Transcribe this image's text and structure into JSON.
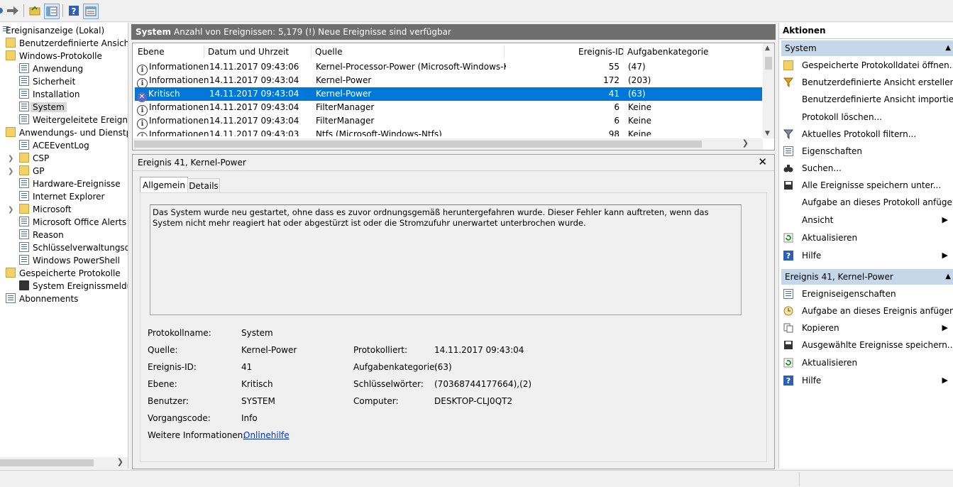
{
  "toolbar": {
    "icons": [
      "back-arrow-icon",
      "forward-arrow-icon",
      "open-folder-icon",
      "console-tree-icon",
      "help-icon",
      "action-pane-icon"
    ]
  },
  "tree": {
    "items": [
      {
        "label": "Ereignisanzeige (Lokal)"
      },
      {
        "label": "Benutzerdefinierte Ansichten"
      },
      {
        "label": "Windows-Protokolle"
      },
      {
        "label": "Anwendung"
      },
      {
        "label": "Sicherheit"
      },
      {
        "label": "Installation"
      },
      {
        "label": "System"
      },
      {
        "label": "Weitergeleitete Ereignisse"
      },
      {
        "label": "Anwendungs- und Dienstprotokolle"
      },
      {
        "label": "ACEEventLog"
      },
      {
        "label": "CSP"
      },
      {
        "label": "GP"
      },
      {
        "label": "Hardware-Ereignisse"
      },
      {
        "label": "Internet Explorer"
      },
      {
        "label": "Microsoft"
      },
      {
        "label": "Microsoft Office Alerts"
      },
      {
        "label": "Reason"
      },
      {
        "label": "Schlüsselverwaltungsdienst"
      },
      {
        "label": "Windows PowerShell"
      },
      {
        "label": "Gespeicherte Protokolle"
      },
      {
        "label": "System Ereignissmeldung"
      },
      {
        "label": "Abonnements"
      }
    ]
  },
  "center": {
    "title": "System",
    "subtitle": "Anzahl von Ereignissen: 5,179 (!) Neue Ereignisse sind verfügbar",
    "columns": [
      "Ebene",
      "Datum und Uhrzeit",
      "Quelle",
      "Ereignis-ID",
      "Aufgabenkategorie"
    ],
    "rows": [
      {
        "level": "Informationen",
        "date": "14.11.2017 09:43:06",
        "source": "Kernel-Processor-Power (Microsoft-Windows-K...",
        "id": "55",
        "category": "(47)"
      },
      {
        "level": "Informationen",
        "date": "14.11.2017 09:43:04",
        "source": "Kernel-Power",
        "id": "172",
        "category": "(203)"
      },
      {
        "level": "Kritisch",
        "date": "14.11.2017 09:43:04",
        "source": "Kernel-Power",
        "id": "41",
        "category": "(63)"
      },
      {
        "level": "Informationen",
        "date": "14.11.2017 09:43:04",
        "source": "FilterManager",
        "id": "6",
        "category": "Keine"
      },
      {
        "level": "Informationen",
        "date": "14.11.2017 09:43:04",
        "source": "FilterManager",
        "id": "6",
        "category": "Keine"
      },
      {
        "level": "Informationen",
        "date": "14.11.2017 09:43:03",
        "source": "Ntfs (Microsoft-Windows-Ntfs)",
        "id": "98",
        "category": "Keine"
      }
    ]
  },
  "detail": {
    "title": "Ereignis 41, Kernel-Power",
    "tabs": [
      "Allgemein",
      "Details"
    ],
    "message": "Das System wurde neu gestartet, ohne dass es zuvor ordnungsgemäß heruntergefahren wurde. Dieser Fehler kann auftreten, wenn das System nicht mehr reagiert hat oder abgestürzt ist oder die Stromzufuhr unerwartet unterbrochen wurde.",
    "fields": {
      "logname_label": "Protokollname:",
      "logname": "System",
      "source_label": "Quelle:",
      "source": "Kernel-Power",
      "logged_label": "Protokolliert:",
      "logged": "14.11.2017 09:43:04",
      "eventid_label": "Ereignis-ID:",
      "eventid": "41",
      "taskcat_label": "Aufgabenkategorie:",
      "taskcat": "(63)",
      "level_label": "Ebene:",
      "level": "Kritisch",
      "keywords_label": "Schlüsselwörter:",
      "keywords": "(70368744177664),(2)",
      "user_label": "Benutzer:",
      "user": "SYSTEM",
      "computer_label": "Computer:",
      "computer": "DESKTOP-CLJ0QT2",
      "opcode_label": "Vorgangscode:",
      "opcode": "Info",
      "moreinfo_label": "Weitere Informationen:",
      "moreinfo_link": "Onlinehilfe"
    }
  },
  "actions": {
    "header": "Aktionen",
    "section1": "System",
    "section1_items": [
      "Gespeicherte Protokolldatei öffnen...",
      "Benutzerdefinierte Ansicht erstellen...",
      "Benutzerdefinierte Ansicht importieren...",
      "Protokoll löschen...",
      "Aktuelles Protokoll filtern...",
      "Eigenschaften",
      "Suchen...",
      "Alle Ereignisse speichern unter...",
      "Aufgabe an dieses Protokoll anfügen...",
      "Ansicht",
      "Aktualisieren",
      "Hilfe"
    ],
    "section2": "Ereignis 41, Kernel-Power",
    "section2_items": [
      "Ereigniseigenschaften",
      "Aufgabe an dieses Ereignis anfügen...",
      "Kopieren",
      "Ausgewählte Ereignisse speichern...",
      "Aktualisieren",
      "Hilfe"
    ]
  },
  "colors": {
    "selection": "#0078d7",
    "section_header": "#c6d7ea",
    "title_bar": "#6e6e6e"
  }
}
